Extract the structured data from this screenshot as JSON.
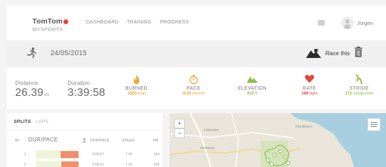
{
  "nav": {
    "logo_tomtom": "TomTom",
    "logo_mysports": "MYSPORTS",
    "links": [
      "DASHBOARD",
      "TRAINING",
      "PROGRESS"
    ],
    "username": "Jürgen"
  },
  "activity": {
    "date": "24/05/2015",
    "race_label": "Race this"
  },
  "stats": {
    "distance_label": "Distance",
    "distance_value": "26.39",
    "distance_unit": "mi",
    "duration_label": "Duration",
    "duration_value": "3:39:58"
  },
  "metrics": [
    {
      "name": "BURNED",
      "value": "3353",
      "unit": "kcal",
      "icon": "flame-icon",
      "color": "#f0a52a"
    },
    {
      "name": "PACE",
      "value": "8:20",
      "unit": "min/mi",
      "icon": "stopwatch-icon",
      "color": "#f0a52a"
    },
    {
      "name": "ELEVATION",
      "value": "810",
      "unit": "ft",
      "icon": "mountain-icon",
      "color": "#8cbf3f"
    },
    {
      "name": "RATE",
      "value": "168",
      "unit": "bpm",
      "icon": "heart-icon",
      "color": "#e2473a"
    },
    {
      "name": "STRIDE",
      "value": "172",
      "unit": "strides/min",
      "icon": "stride-icon",
      "color": "#8cbf3f"
    }
  ],
  "splits": {
    "tab_splits": "SPLITS",
    "tab_laps": "LAPS",
    "col_mi": "MI",
    "col_pace": "DUR/PACE",
    "col_dur": "DUR/PACE",
    "col_speed": "SPEED",
    "col_hr": "HR",
    "sort_icon": "sort-icon",
    "rows": [
      {
        "mi": "1",
        "dur": "0:08:07",
        "speed": "7.40",
        "hr": "164",
        "pace_fill": 0.42
      },
      {
        "mi": "2",
        "dur": "0:08:12",
        "speed": "7.34",
        "hr": "165",
        "pace_fill": 0.4
      }
    ]
  },
  "map": {
    "zoom_in": "+",
    "zoom_out": "−",
    "labels": [
      "Uttersley",
      "Bellahøj",
      "Nordhavn"
    ]
  },
  "colors": {
    "accent_red": "#e2473a",
    "orange": "#f0a52a",
    "green": "#8cbf3f"
  }
}
